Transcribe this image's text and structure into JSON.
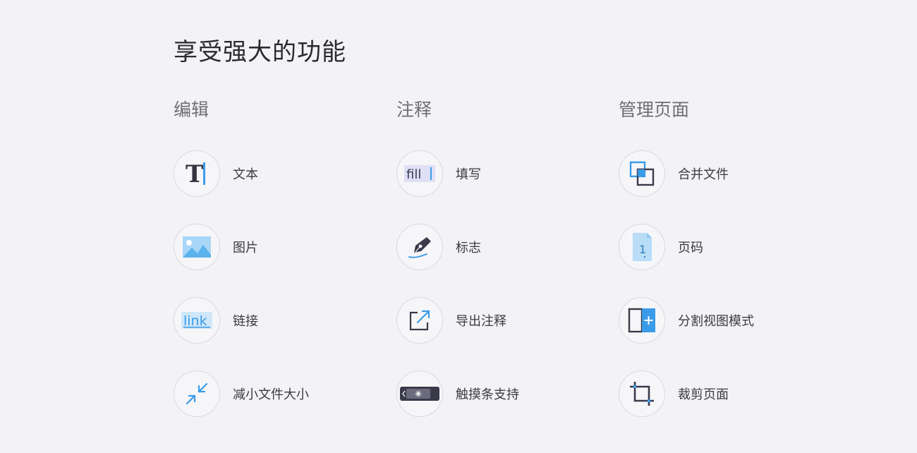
{
  "title": "享受强大的功能",
  "columns": [
    {
      "title": "编辑",
      "features": [
        {
          "label": "文本",
          "icon": "text-icon"
        },
        {
          "label": "图片",
          "icon": "image-icon"
        },
        {
          "label": "链接",
          "icon": "link-icon",
          "icon_text": "link"
        },
        {
          "label": "减小文件大小",
          "icon": "compress-icon"
        }
      ]
    },
    {
      "title": "注释",
      "features": [
        {
          "label": "填写",
          "icon": "fill-icon",
          "icon_text": "fill"
        },
        {
          "label": "标志",
          "icon": "pen-nib-icon"
        },
        {
          "label": "导出注释",
          "icon": "export-icon"
        },
        {
          "label": "触摸条支持",
          "icon": "touch-bar-icon"
        }
      ]
    },
    {
      "title": "管理页面",
      "features": [
        {
          "label": "合并文件",
          "icon": "merge-icon"
        },
        {
          "label": "页码",
          "icon": "page-number-icon",
          "icon_text": "1"
        },
        {
          "label": "分割视图模式",
          "icon": "split-view-icon"
        },
        {
          "label": "裁剪页面",
          "icon": "crop-icon"
        }
      ]
    }
  ],
  "colors": {
    "background": "#f3f3f7",
    "accent_blue": "#3a9be8",
    "light_blue": "#a7d6f7",
    "dark_icon": "#3a3a4a"
  }
}
